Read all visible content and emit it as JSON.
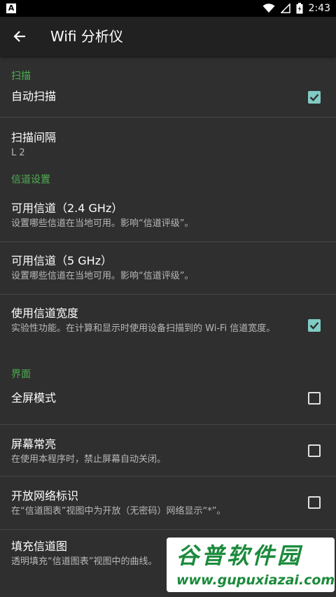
{
  "status_bar": {
    "left_icon_letter": "A",
    "time": "2:43"
  },
  "app_bar": {
    "title": "Wifi 分析仪"
  },
  "sections": [
    {
      "category": "扫描",
      "items": [
        {
          "title": "自动扫描",
          "summary": "",
          "checkbox": true
        },
        {
          "title": "扫描间隔",
          "summary": "L 2",
          "checkbox": null
        }
      ]
    },
    {
      "category": "信道设置",
      "items": [
        {
          "title": "可用信道（2.4 GHz）",
          "summary": "设置哪些信道在当地可用。影响“信道评级”。",
          "checkbox": null
        },
        {
          "title": "可用信道（5 GHz）",
          "summary": "设置哪些信道在当地可用。影响“信道评级”。",
          "checkbox": null
        },
        {
          "title": "使用信道宽度",
          "summary": "实验性功能。在计算和显示时使用设备扫描到的 Wi-Fi 信道宽度。",
          "checkbox": true
        }
      ]
    },
    {
      "category": "界面",
      "items": [
        {
          "title": "全屏模式",
          "summary": "",
          "checkbox": false
        },
        {
          "title": "屏幕常亮",
          "summary": "在使用本程序时，禁止屏幕自动关闭。",
          "checkbox": false
        },
        {
          "title": "开放网络标识",
          "summary": "在“信道图表”视图中为开放（无密码）网络显示“*”。",
          "checkbox": false
        },
        {
          "title": "填充信道图",
          "summary": "透明填充“信道图表”视图中的曲线。",
          "checkbox": null
        }
      ]
    }
  ],
  "watermark": {
    "main": "谷普软件园",
    "url": "www.gupuxiazai.com"
  },
  "colors": {
    "accent": "#4caf50",
    "checkbox_checked": "#80cbc4",
    "background": "#2f2f2f",
    "app_bar": "#212121"
  },
  "icons": {
    "back": "arrow-back-icon",
    "wifi": "wifi-icon",
    "signal": "signal-icon",
    "battery": "battery-icon",
    "check": "check-icon"
  }
}
